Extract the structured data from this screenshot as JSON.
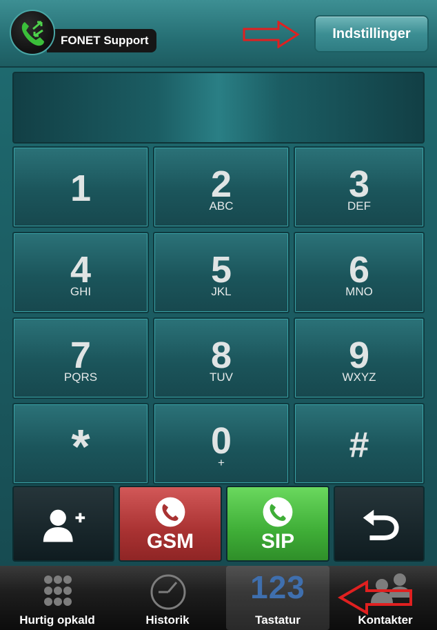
{
  "header": {
    "account_name": "FONET Support",
    "settings_label": "Indstillinger"
  },
  "keypad": {
    "keys": [
      {
        "digit": "1",
        "letters": ""
      },
      {
        "digit": "2",
        "letters": "ABC"
      },
      {
        "digit": "3",
        "letters": "DEF"
      },
      {
        "digit": "4",
        "letters": "GHI"
      },
      {
        "digit": "5",
        "letters": "JKL"
      },
      {
        "digit": "6",
        "letters": "MNO"
      },
      {
        "digit": "7",
        "letters": "PQRS"
      },
      {
        "digit": "8",
        "letters": "TUV"
      },
      {
        "digit": "9",
        "letters": "WXYZ"
      },
      {
        "digit": "*",
        "letters": ""
      },
      {
        "digit": "0",
        "letters": "+"
      },
      {
        "digit": "#",
        "letters": ""
      }
    ]
  },
  "actions": {
    "add_contact_icon": "add-contact-icon",
    "gsm_label": "GSM",
    "sip_label": "SIP",
    "backspace_icon": "backspace-icon"
  },
  "tabs": {
    "quick_dial": "Hurtig opkald",
    "history": "Historik",
    "keypad": "Tastatur",
    "keypad_icon_text": "123",
    "contacts": "Kontakter",
    "active": "Tastatur"
  },
  "colors": {
    "accent_teal": "#2b7278",
    "gsm_red": "#a93232",
    "sip_green": "#3fae37",
    "annotation_red": "#e02020"
  }
}
